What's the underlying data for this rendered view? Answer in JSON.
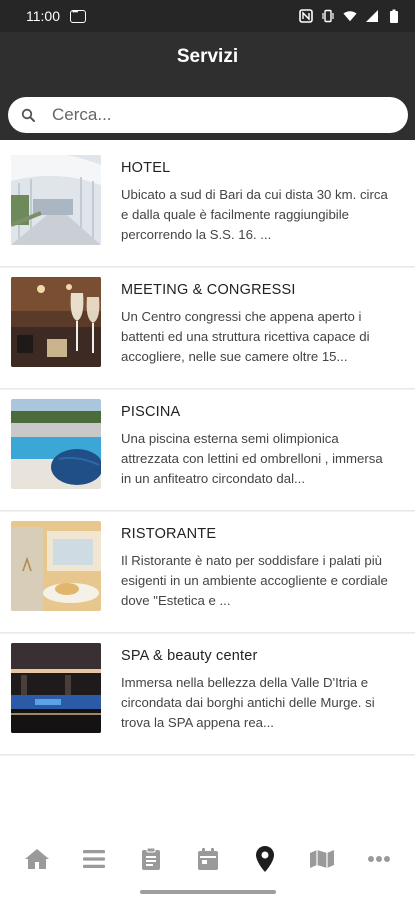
{
  "status": {
    "time": "11:00"
  },
  "header": {
    "title": "Servizi"
  },
  "search": {
    "placeholder": "Cerca..."
  },
  "services": [
    {
      "name": "HOTEL",
      "description": "Ubicato a sud di Bari da cui dista 30 km. circa e dalla quale è facilmente raggiungibile percorrendo la S.S. 16. ..."
    },
    {
      "name": "MEETING & CONGRESSI",
      "description": "Un Centro congressi che appena aperto i battenti ed una struttura ricettiva capace di accogliere,  nelle sue camere oltre 15..."
    },
    {
      "name": "PISCINA",
      "description": "Una piscina esterna semi olimpionica attrezzata con lettini ed ombrelloni , immersa in un anfiteatro circondato dal..."
    },
    {
      "name": "RISTORANTE",
      "description": "Il Ristorante   è nato per soddisfare i palati più esigenti in un ambiente accogliente e cordiale dove \"Estetica e ..."
    },
    {
      "name": "SPA & beauty center",
      "description": "Immersa nella bellezza della Valle D'Itria e circondata dai borghi antichi delle Murge. si trova la  SPA appena rea..."
    }
  ],
  "nav": {
    "items": [
      "home-icon",
      "menu-icon",
      "clipboard-icon",
      "calendar-icon",
      "location-pin-icon",
      "map-icon",
      "more-icon"
    ],
    "active": "location-pin-icon",
    "active_color": "#1e1e1e",
    "inactive_color": "#9a9a9a"
  },
  "colors": {
    "appbar": "#2f2f2f",
    "statusbar": "#262626"
  }
}
